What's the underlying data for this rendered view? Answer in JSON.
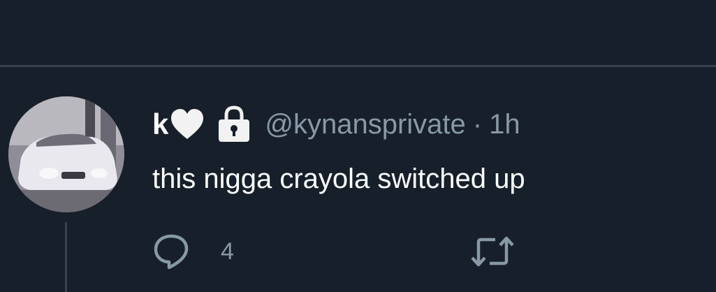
{
  "tweet": {
    "display_name": "k",
    "handle": "@kynansprivate",
    "separator": "·",
    "time": "1h",
    "text": "this nigga crayola switched up",
    "name_icons": [
      "white-heart-icon",
      "lock-icon"
    ],
    "reply_count": "4"
  },
  "colors": {
    "background": "#161f2a",
    "divider": "#38444d",
    "secondary_text": "#8899a6",
    "primary_text": "#ffffff"
  },
  "icons": {
    "reply": "reply-icon",
    "retweet": "retweet-icon"
  }
}
